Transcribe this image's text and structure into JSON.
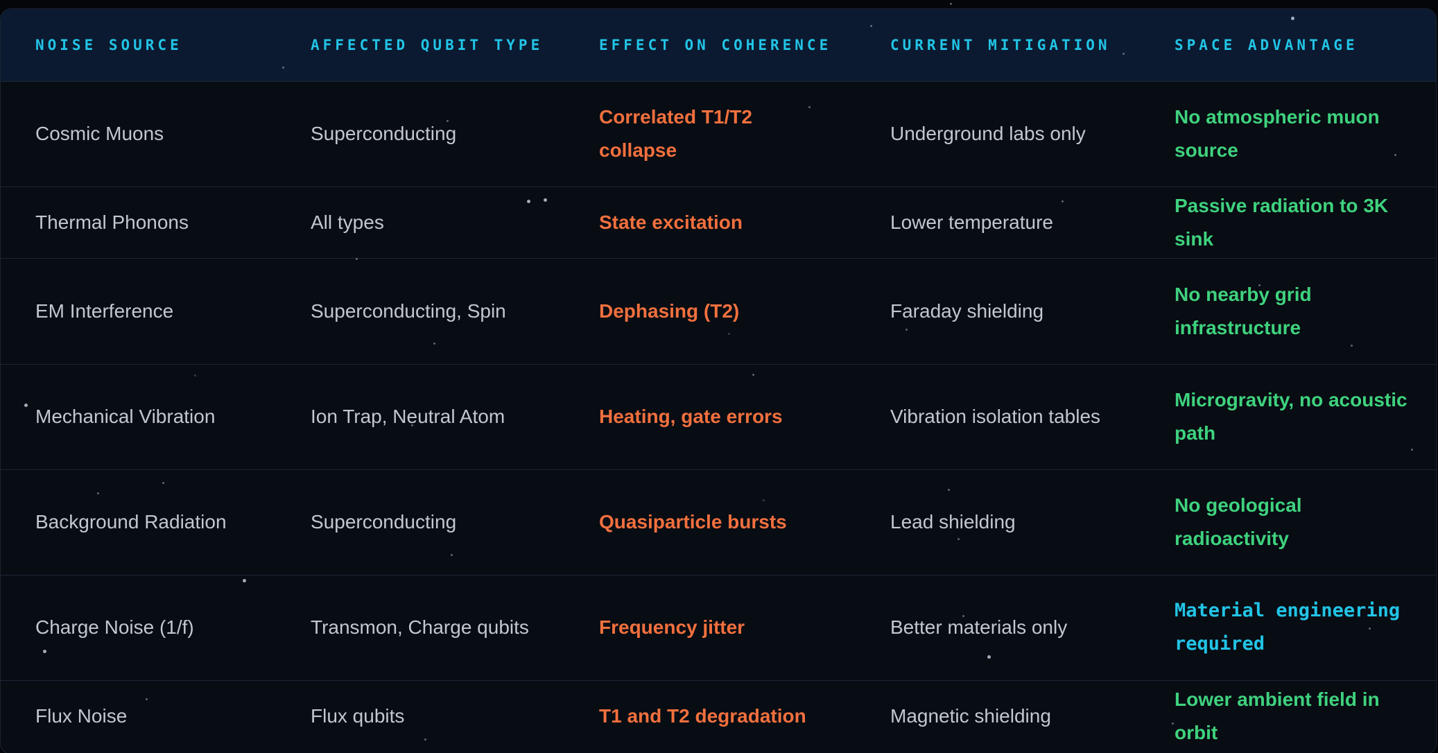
{
  "table": {
    "headers": [
      "NOISE SOURCE",
      "AFFECTED QUBIT TYPE",
      "EFFECT ON COHERENCE",
      "CURRENT MITIGATION",
      "SPACE ADVANTAGE"
    ],
    "rows": [
      {
        "source": "Cosmic Muons",
        "qubit": "Superconducting",
        "effect": "Correlated T1/T2 collapse",
        "mitigation": "Underground labs only",
        "advantage": "No atmospheric muon source"
      },
      {
        "source": "Thermal Phonons",
        "qubit": "All types",
        "effect": "State excitation",
        "mitigation": "Lower temperature",
        "advantage": "Passive radiation to 3K sink"
      },
      {
        "source": "EM Interference",
        "qubit": "Superconducting, Spin",
        "effect": "Dephasing (T2)",
        "mitigation": "Faraday shielding",
        "advantage": "No nearby grid infrastructure"
      },
      {
        "source": "Mechanical Vibration",
        "qubit": "Ion Trap, Neutral Atom",
        "effect": "Heating, gate errors",
        "mitigation": "Vibration isolation tables",
        "advantage": "Microgravity, no acoustic path"
      },
      {
        "source": "Background Radiation",
        "qubit": "Superconducting",
        "effect": "Quasiparticle bursts",
        "mitigation": "Lead shielding",
        "advantage": "No geological radioactivity"
      },
      {
        "source": "Charge Noise (1/f)",
        "qubit": "Transmon, Charge qubits",
        "effect": "Frequency jitter",
        "mitigation": "Better materials only",
        "advantage": "Material engineering required"
      },
      {
        "source": "Flux Noise",
        "qubit": "Flux qubits",
        "effect": "T1 and T2 degradation",
        "mitigation": "Magnetic shielding",
        "advantage": "Lower ambient field in orbit"
      }
    ]
  },
  "colors": {
    "header_text": "#22c4e6",
    "effect_text": "#f1703e",
    "advantage_text": "#3fd27e",
    "advantage_alt_text": "#22c4e6",
    "body_text": "#c2c7d0",
    "header_bg": "#0b1a30",
    "background": "#04060a"
  }
}
